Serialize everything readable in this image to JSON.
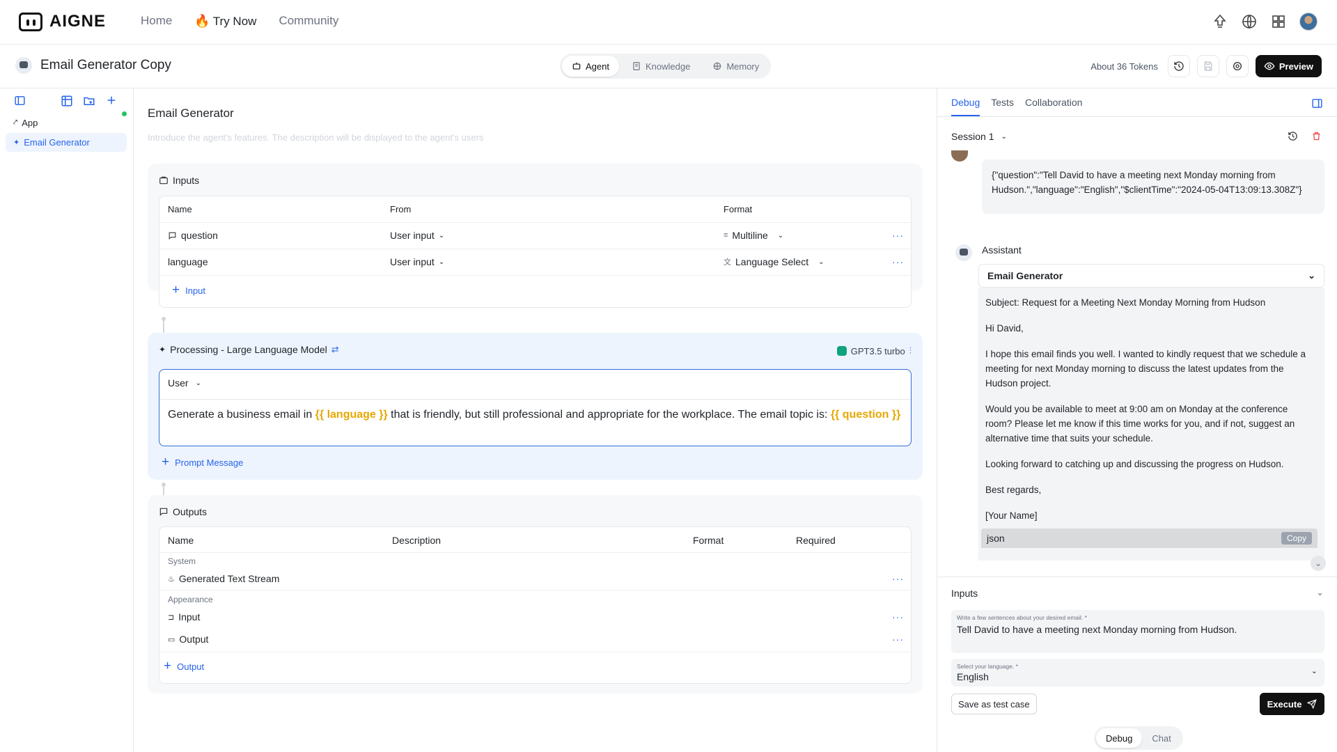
{
  "brand": {
    "name": "AIGNE"
  },
  "nav": {
    "home": "Home",
    "try_now": "Try Now",
    "community": "Community"
  },
  "project": {
    "title": "Email Generator Copy",
    "tabs": [
      "Agent",
      "Knowledge",
      "Memory"
    ],
    "active_tab": "Agent",
    "tokens": "About 36 Tokens",
    "preview": "Preview"
  },
  "sidebar": {
    "items": [
      {
        "label": "App"
      },
      {
        "label": "Email Generator"
      }
    ]
  },
  "agent": {
    "title": "Email Generator",
    "description_placeholder": "Introduce the agent's features. The description will be displayed to the agent's users"
  },
  "inputs_section": {
    "title": "Inputs",
    "headers": [
      "Name",
      "From",
      "Format"
    ],
    "rows": [
      {
        "name": "question",
        "from": "User input",
        "format": "Multiline"
      },
      {
        "name": "language",
        "from": "User input",
        "format": "Language Select"
      }
    ],
    "add_label": "Input"
  },
  "processing": {
    "title": "Processing - Large Language Model",
    "model": "GPT3.5 turbo",
    "role": "User",
    "prompt_part1": "Generate a business email in ",
    "prompt_var1": "{{ language }}",
    "prompt_part2": " that is friendly, but still professional and appropriate for the workplace. The email topic is: ",
    "prompt_var2": "{{ question }}",
    "prompt_var2_end": "}}",
    "add_label": "Prompt Message"
  },
  "outputs_section": {
    "title": "Outputs",
    "headers": [
      "Name",
      "Description",
      "Format",
      "Required"
    ],
    "group_system": "System",
    "system_rows": [
      "Generated Text Stream"
    ],
    "group_appearance": "Appearance",
    "appearance_rows": [
      "Input",
      "Output"
    ],
    "add_label": "Output"
  },
  "debug": {
    "tabs": [
      "Debug",
      "Tests",
      "Collaboration"
    ],
    "session": "Session 1",
    "user_message": "{\"question\":\"Tell David to have a meeting next Monday morning from Hudson.\",\"language\":\"English\",\"$clientTime\":\"2024-05-04T13:09:13.308Z\"}",
    "assistant_label": "Assistant",
    "agent_select": "Email Generator",
    "email_lines": [
      "Subject: Request for a Meeting Next Monday Morning from Hudson",
      "Hi David,",
      "I hope this email finds you well. I wanted to kindly request that we schedule a meeting for next Monday morning to discuss the latest updates from the Hudson project.",
      "Would you be available to meet at 9:00 am on Monday at the conference room? Please let me know if this time works for you, and if not, suggest an alternative time that suits your schedule.",
      "Looking forward to catching up and discussing the progress on Hudson.",
      "Best regards,",
      "[Your Name]"
    ],
    "code_lang": "json",
    "copy_label": "Copy",
    "inputs_title": "Inputs",
    "field1_label": "Write a few sentences about your desired email. *",
    "field1_value": "Tell David to have a meeting next Monday morning from Hudson.",
    "field2_label": "Select your language. *",
    "field2_value": "English",
    "save_test": "Save as test case",
    "execute": "Execute",
    "modes": [
      "Debug",
      "Chat"
    ],
    "active_mode": "Debug"
  }
}
